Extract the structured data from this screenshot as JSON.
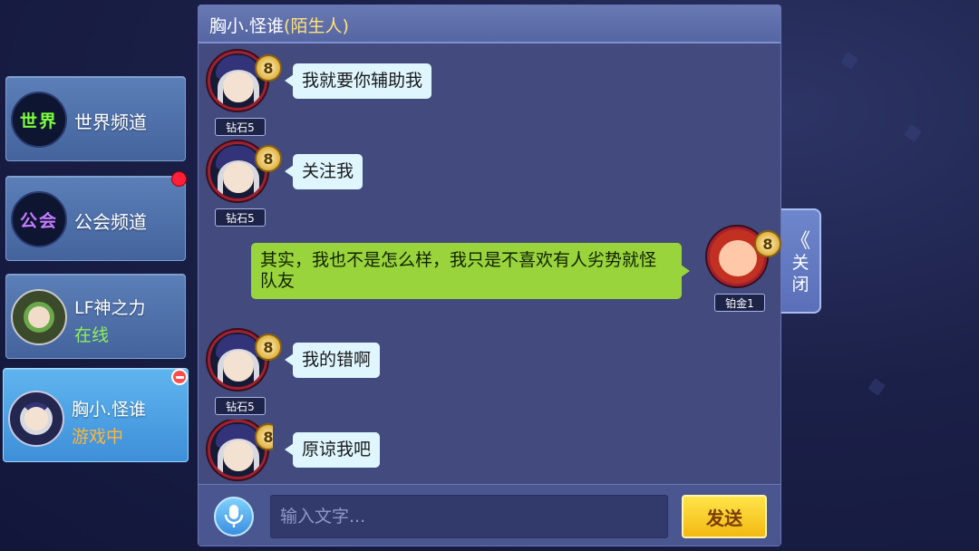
{
  "channels": [
    {
      "icon_text": "世界",
      "label": "世界频道"
    },
    {
      "icon_text": "公会",
      "label": "公会频道"
    }
  ],
  "contacts": [
    {
      "name": "LF神之力",
      "status": "在线"
    },
    {
      "name": "胸小.怪谁",
      "status": "游戏中"
    }
  ],
  "chat": {
    "title": "胸小.怪谁",
    "title_tag": "(陌生人)",
    "messages": [
      {
        "side": "left",
        "level": "8",
        "rank": "钻石5",
        "text": "我就要你辅助我"
      },
      {
        "side": "left",
        "level": "8",
        "rank": "钻石5",
        "text": "关注我"
      },
      {
        "side": "right",
        "level": "8",
        "rank": "铂金1",
        "text": "其实，我也不是怎么样，我只是不喜欢有人劣势就怪队友"
      },
      {
        "side": "left",
        "level": "8",
        "rank": "钻石5",
        "text": "我的错啊"
      },
      {
        "side": "left",
        "level": "8",
        "rank": "",
        "text": "原谅我吧"
      }
    ]
  },
  "input": {
    "placeholder": "输入文字...",
    "send_label": "发送"
  },
  "close_tab": {
    "chevron": "《",
    "label": "关闭"
  },
  "icons": {
    "mic": "microphone-icon",
    "unread": "red-dot-icon",
    "remove": "minus-circle-icon"
  },
  "colors": {
    "panel": "#424a7e",
    "header": "#5566a3",
    "bubble_in": "#dff6ff",
    "bubble_out": "#9ad43c",
    "send_button": "#f3b812",
    "online": "#8cf05a",
    "ingame": "#ffb43a",
    "stranger_tag": "#ffe27a"
  }
}
